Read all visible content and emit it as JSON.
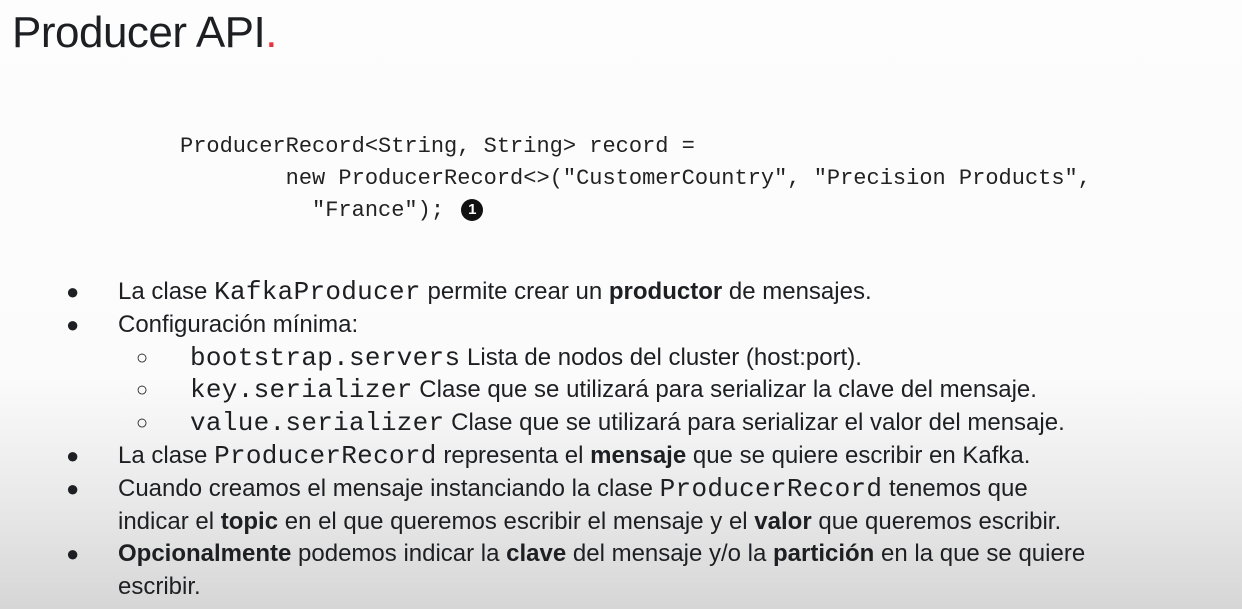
{
  "title": {
    "text": "Producer API",
    "dot": "."
  },
  "code": {
    "line1": "ProducerRecord<String, String> record =",
    "line2": "        new ProducerRecord<>(\"CustomerCountry\", \"Precision Products\",",
    "line3": "          \"France\");",
    "callout": "1"
  },
  "bullets": {
    "b1": {
      "pre": "La clase ",
      "code": "KafkaProducer",
      "mid": " permite crear un ",
      "bold": "productor",
      "post": " de mensajes."
    },
    "b2": {
      "text": "Configuración mínima:"
    },
    "sub": [
      {
        "code": "bootstrap.servers",
        "text": " Lista de nodos del cluster (host:port)."
      },
      {
        "code": "key.serializer",
        "text": " Clase que se utilizará para serializar la clave del mensaje."
      },
      {
        "code": "value.serializer",
        "text": " Clase que se utilizará para serializar el valor del mensaje."
      }
    ],
    "b3": {
      "pre": "La clase ",
      "code": "ProducerRecord",
      "mid": " representa el ",
      "bold": "mensaje",
      "post": " que se quiere escribir en Kafka."
    },
    "b4": {
      "pre": "Cuando creamos el mensaje instanciando la clase ",
      "code": "ProducerRecord",
      "post": " tenemos que",
      "l2a": "indicar el ",
      "bold1": "topic",
      "l2b": " en el que queremos escribir el mensaje y el ",
      "bold2": "valor",
      "l2c": " que queremos escribir."
    },
    "b5": {
      "bold1": "Opcionalmente",
      "a": " podemos indicar la ",
      "bold2": "clave",
      "b": " del mensaje y/o la ",
      "bold3": "partición",
      "c": " en la que se quiere",
      "l2": "escribir."
    },
    "bullet": "●",
    "subbullet": "○"
  }
}
